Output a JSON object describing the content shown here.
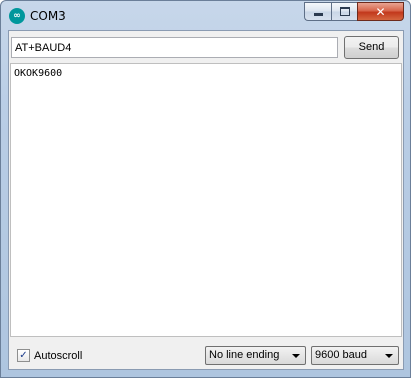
{
  "window": {
    "title": "COM3",
    "app_icon_glyph": "∞",
    "icon": "arduino-icon",
    "caption_buttons": {
      "minimize_icon": "minimize-icon",
      "maximize_icon": "maximize-icon",
      "close_icon": "close-icon",
      "close_glyph": "✕"
    }
  },
  "toolbar": {
    "command_value": "AT+BAUD4",
    "send_label": "Send"
  },
  "output": {
    "text": "OKOK9600"
  },
  "footer": {
    "autoscroll_label": "Autoscroll",
    "autoscroll_checked": true,
    "checkmark": "✓",
    "line_ending_selected": "No line ending",
    "baud_selected": "9600 baud"
  },
  "colors": {
    "arduino_teal": "#00979c",
    "close_red": "#c2381c"
  }
}
